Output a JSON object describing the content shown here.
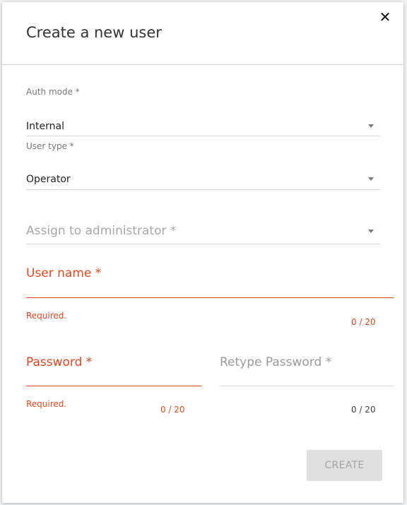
{
  "dialog": {
    "title": "Create a new user",
    "close_glyph": "✕"
  },
  "auth_mode": {
    "label": "Auth mode *",
    "value": "Internal"
  },
  "user_type": {
    "label": "User type *",
    "value": "Operator"
  },
  "assign_admin": {
    "placeholder": "Assign to administrator *"
  },
  "user_name": {
    "label": "User name *",
    "error": "Required.",
    "counter": "0 / 20"
  },
  "password": {
    "label": "Password *",
    "error": "Required.",
    "counter": "0 / 20"
  },
  "retype_password": {
    "label": "Retype Password *",
    "counter": "0 / 20"
  },
  "actions": {
    "create_label": "CREATE"
  },
  "colors": {
    "error": "#e8451e",
    "disabled_button_bg": "#e0e0e0",
    "disabled_button_text": "#a5a5a5"
  }
}
